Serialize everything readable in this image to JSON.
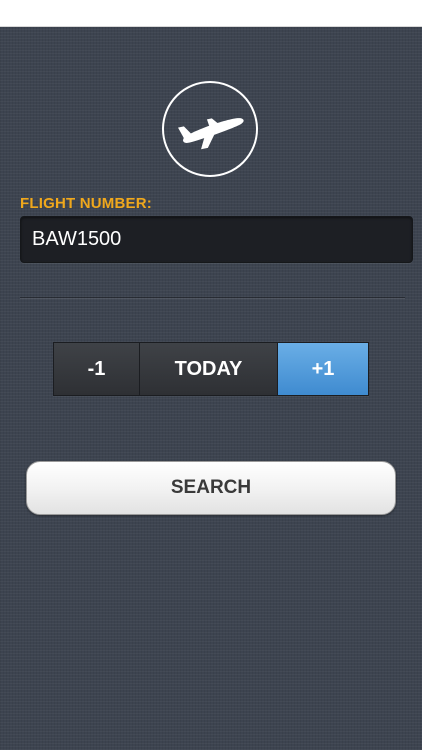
{
  "form": {
    "flight_label": "FLIGHT NUMBER:",
    "flight_value": "BAW1500"
  },
  "day_selector": {
    "minus_label": "-1",
    "today_label": "TODAY",
    "plus_label": "+1",
    "selected": "+1"
  },
  "search": {
    "label": "SEARCH"
  },
  "icons": {
    "logo": "airplane-icon"
  },
  "colors": {
    "accent_label": "#f0a81c",
    "selected_day": "#4f9bdc",
    "background": "#3d4450"
  }
}
